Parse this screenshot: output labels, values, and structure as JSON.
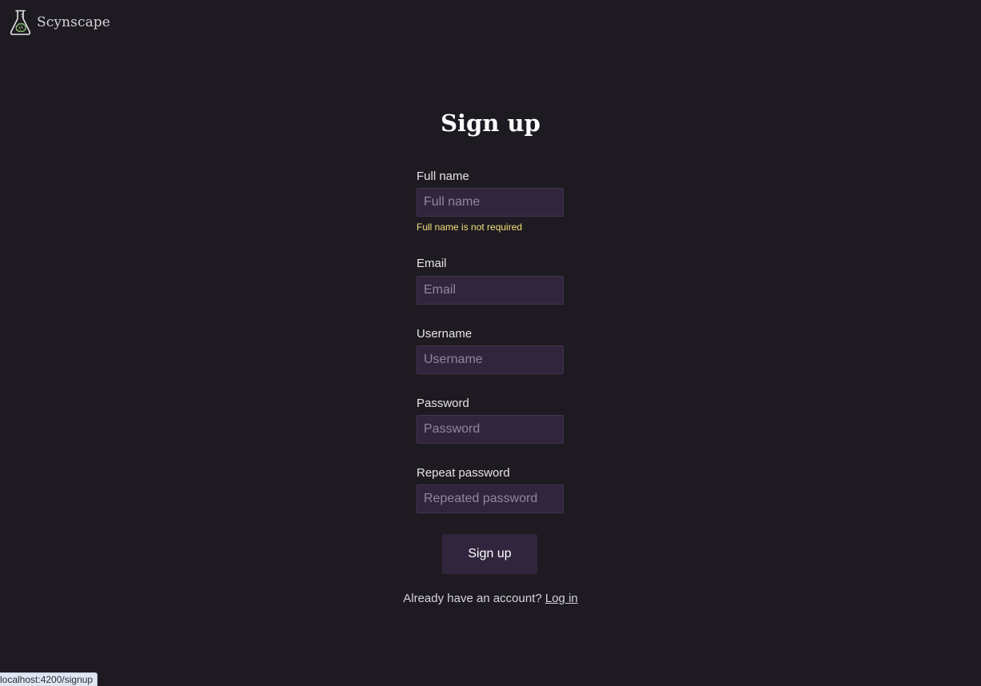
{
  "header": {
    "brand_name": "Scynscape",
    "brand_icon": "flask-brain-icon"
  },
  "form": {
    "title": "Sign up",
    "fields": [
      {
        "label": "Full name",
        "placeholder": "Full name",
        "value": "",
        "hint": "Full name is not required"
      },
      {
        "label": "Email",
        "placeholder": "Email",
        "value": ""
      },
      {
        "label": "Username",
        "placeholder": "Username",
        "value": ""
      },
      {
        "label": "Password",
        "placeholder": "Password",
        "value": ""
      },
      {
        "label": "Repeat password",
        "placeholder": "Repeated password",
        "value": ""
      }
    ],
    "submit_label": "Sign up",
    "login_prompt": "Already have an account?",
    "login_link": "Log in"
  },
  "status_bar": {
    "url": "localhost:4200/signup"
  },
  "colors": {
    "background": "#1d1a21",
    "input_background": "#31253d",
    "hint": "#f1e07b",
    "icon_accent": "#8fc773"
  }
}
